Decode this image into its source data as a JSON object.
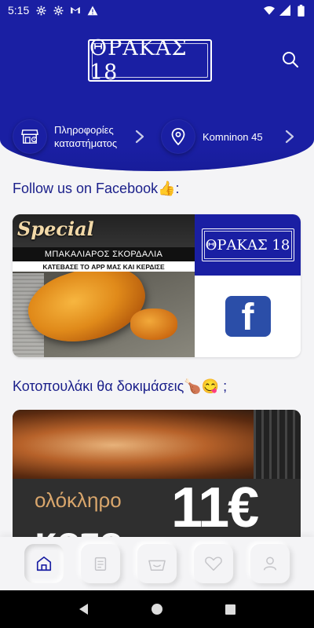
{
  "status_bar": {
    "time": "5:15",
    "notification_icons": [
      "settings-icon",
      "settings-icon",
      "gmail-icon",
      "warning-icon"
    ],
    "system_icons": [
      "wifi-icon",
      "signal-icon",
      "battery-icon"
    ]
  },
  "header": {
    "logo_text": "ΘΡΑΚΑΣ 18",
    "search_icon": "search-icon",
    "store_info_label": "Πληροφορίες καταστήματος",
    "store_info_line1": "Πληροφορίες",
    "store_info_line2": "καταστήματος",
    "address_label": "Komninon 45",
    "colors": {
      "primary": "#1a1fa3",
      "text": "#ffffff"
    }
  },
  "facebook_section": {
    "title": "Follow us on Facebook👍:",
    "promo_special": "Special",
    "promo_title": "ΜΠΑΚΑΛΙΑΡΟΣ ΣΚΟΡΔΑΛΙΑ",
    "promo_subtitle": "ΚΑΤΕΒΑΣΕ ΤΟ APP ΜΑΣ ΚΑΙ ΚΕΡΔΙΣΕ",
    "mini_logo": "ΘΡΑΚΑΣ 18",
    "fb_letter": "f"
  },
  "chicken_section": {
    "title": "Κοτοπουλάκι θα δοκιμάσεις🍗😋 ;",
    "promo_whole": "ολόκληρο",
    "promo_price": "11€",
    "promo_word": "κοτο"
  },
  "bottom_nav": {
    "items": [
      "home-icon",
      "menu-icon",
      "basket-icon",
      "heart-icon",
      "profile-icon"
    ],
    "active": "home-icon"
  },
  "system_nav": [
    "back-icon",
    "home-circle-icon",
    "recents-icon"
  ]
}
